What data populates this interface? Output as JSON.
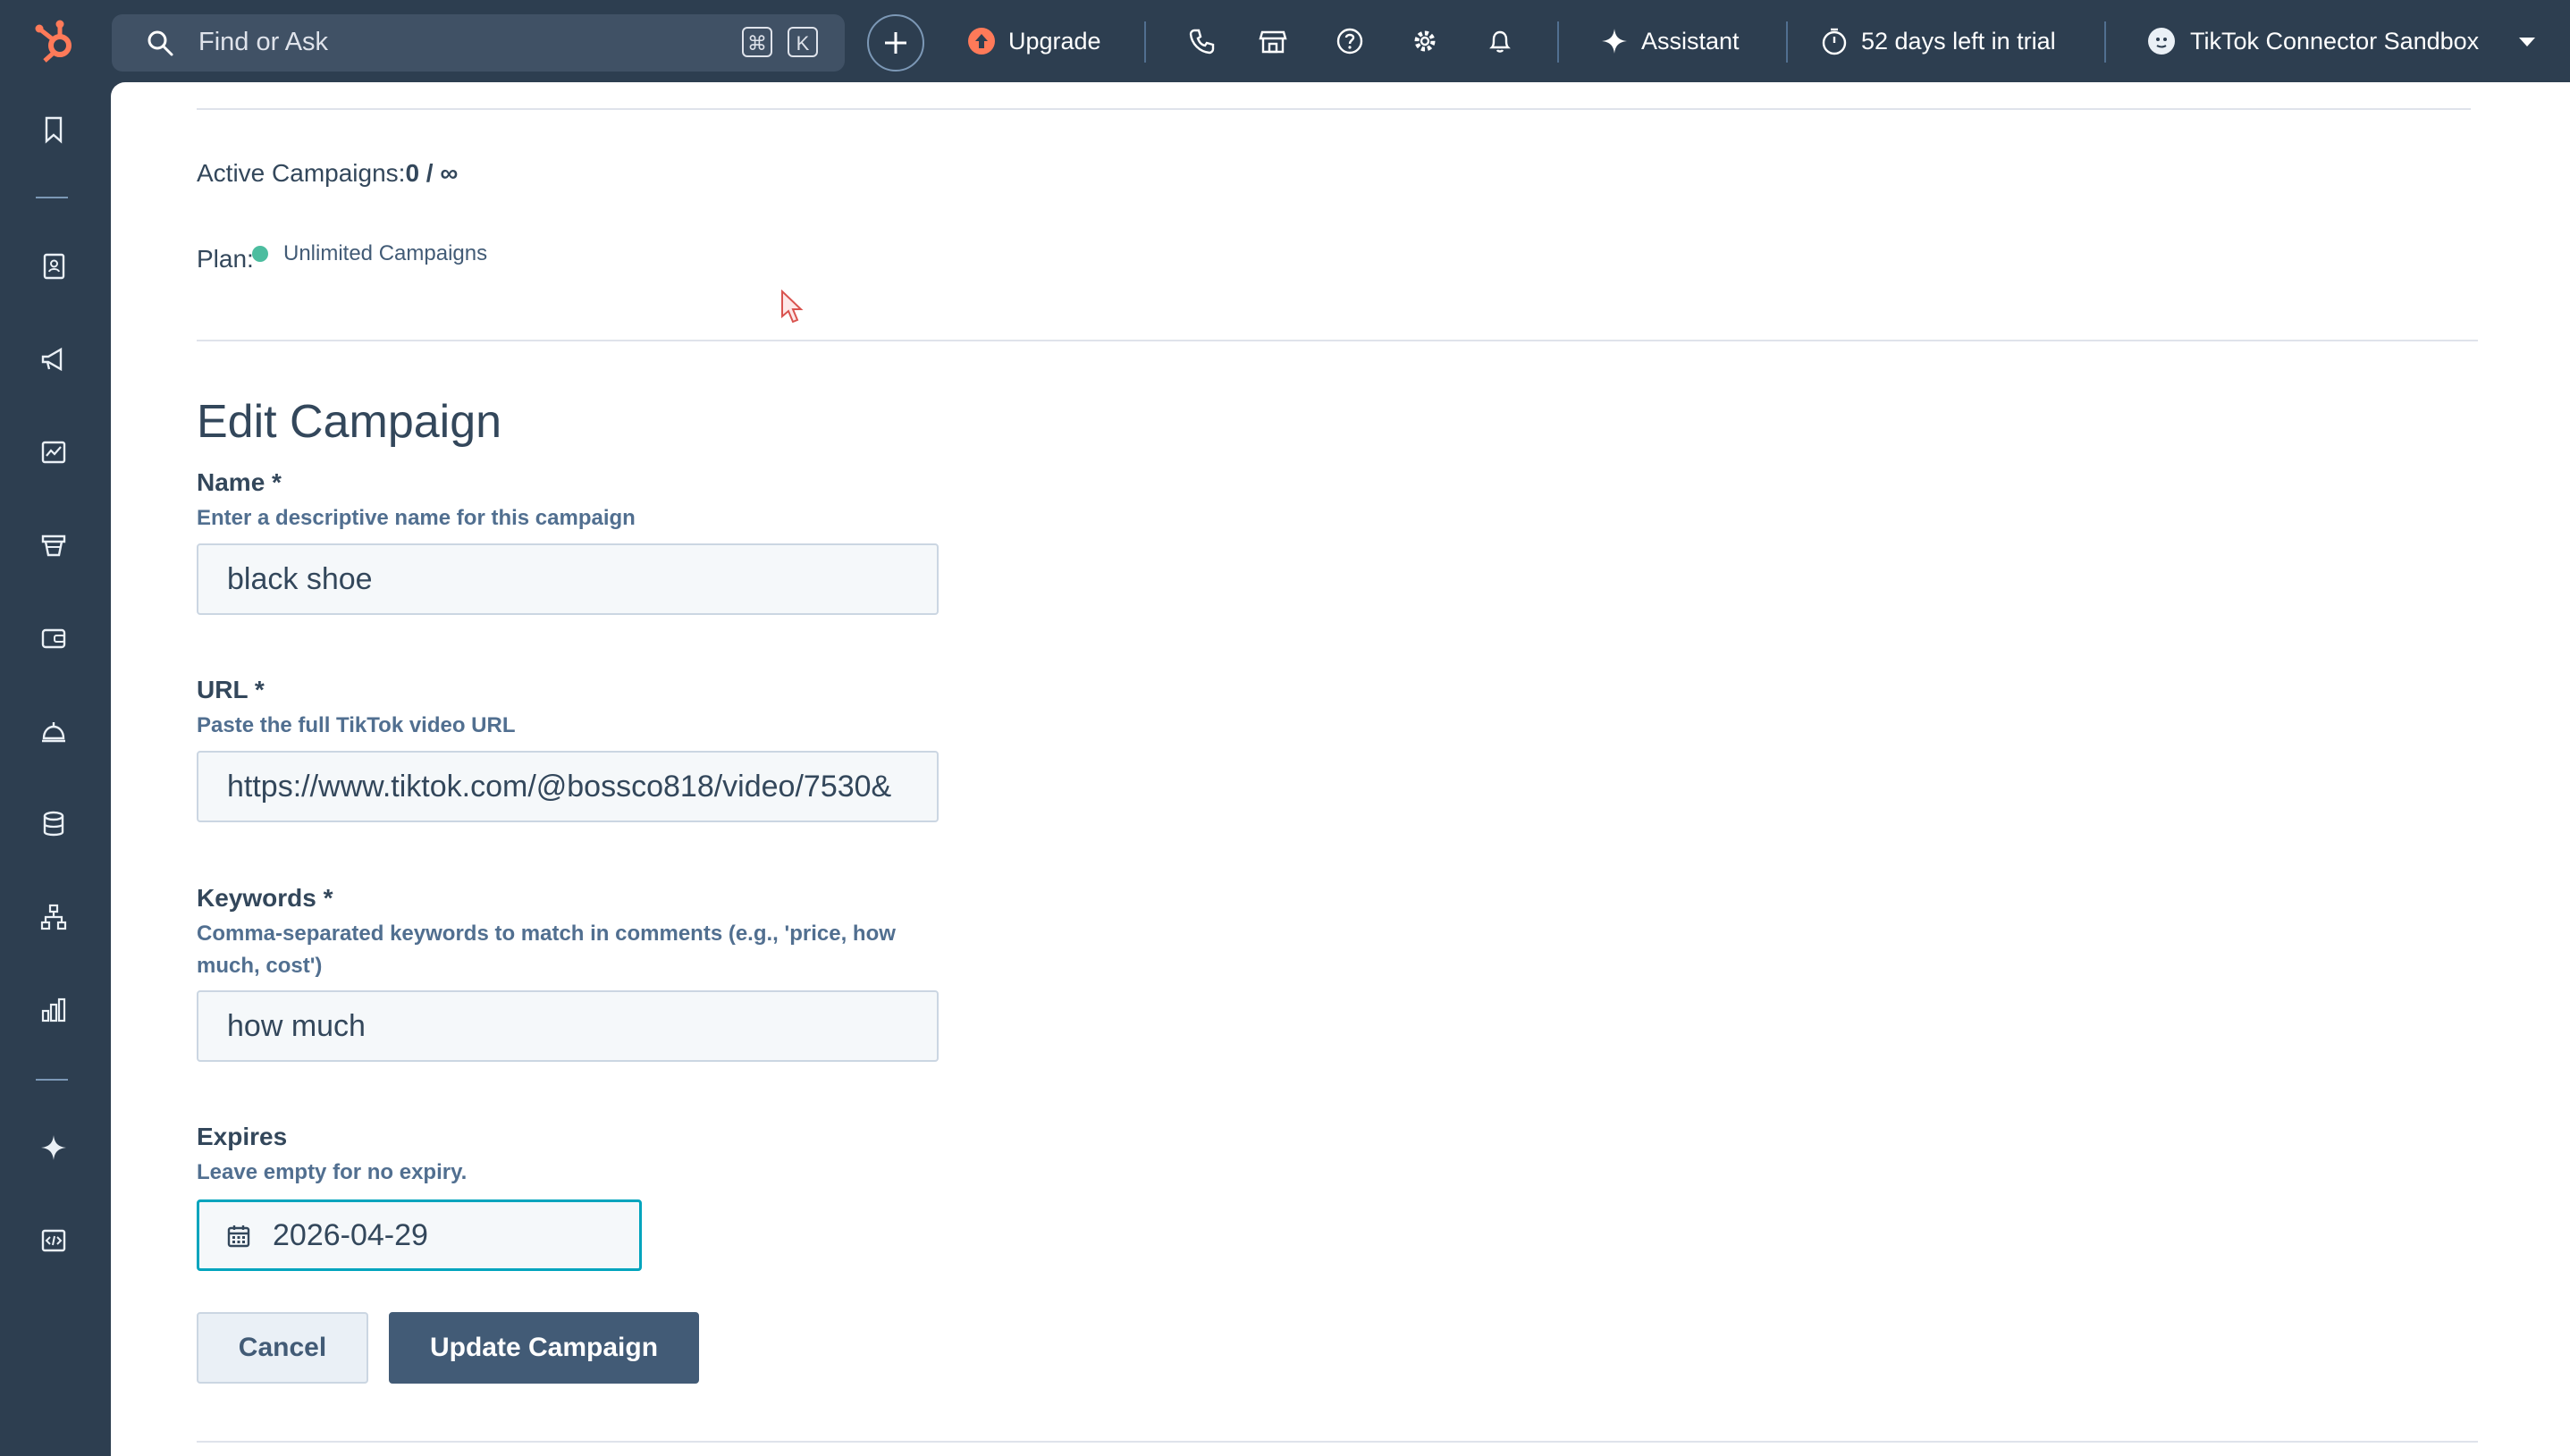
{
  "topbar": {
    "search_placeholder": "Find or Ask",
    "shortcut_cmd": "⌘",
    "shortcut_key": "K",
    "upgrade_label": "Upgrade",
    "assistant_label": "Assistant",
    "trial_label": "52 days left in trial",
    "account_label": "TikTok Connector Sandbox"
  },
  "sidebar": {
    "icons": [
      "bookmark-icon",
      "contacts-icon",
      "marketing-icon",
      "content-icon",
      "commerce-icon",
      "payments-icon",
      "service-icon",
      "data-icon",
      "automation-icon",
      "reporting-icon",
      "breeze-icon",
      "developer-icon"
    ]
  },
  "stats": {
    "active_label": "Active Campaigns:",
    "active_value": "0 / ∞",
    "plan_label": "Plan:",
    "plan_value": "Unlimited Campaigns"
  },
  "form": {
    "title": "Edit Campaign",
    "name_label": "Name *",
    "name_help": "Enter a descriptive name for this campaign",
    "name_value": "black shoe",
    "url_label": "URL *",
    "url_help": "Paste the full TikTok video URL",
    "url_value": "https://www.tiktok.com/@bossco818/video/7530&",
    "keywords_label": "Keywords *",
    "keywords_help": "Comma-separated keywords to match in comments (e.g., 'price, how much, cost')",
    "keywords_value": "how much",
    "expires_label": "Expires",
    "expires_help": "Leave empty for no expiry.",
    "expires_value": "2026-04-29",
    "cancel_label": "Cancel",
    "submit_label": "Update Campaign"
  },
  "colors": {
    "topbar_bg": "#2d3e50",
    "accent_teal": "#00a4bd",
    "plan_dot": "#4cbd9f",
    "primary_button": "#425b76",
    "hubspot_orange": "#ff7a59"
  }
}
